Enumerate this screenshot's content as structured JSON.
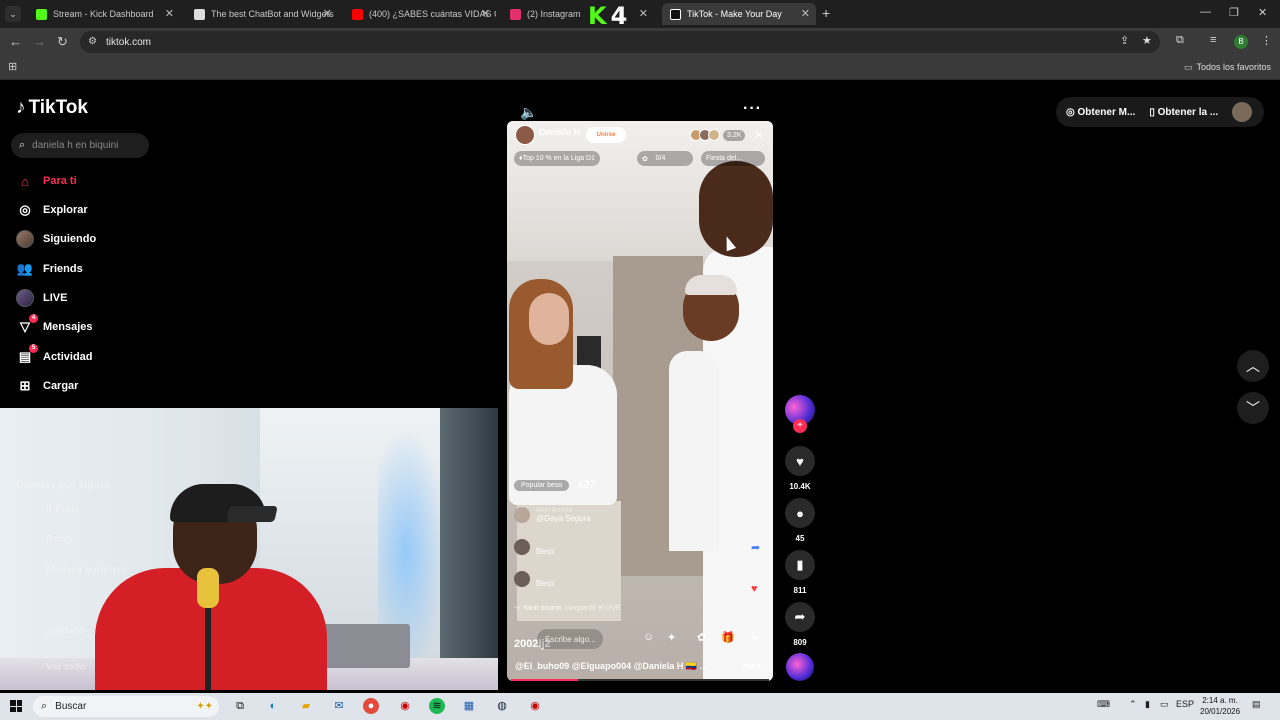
{
  "browser": {
    "tabs": [
      {
        "title": "Stream - Kick Dashboard",
        "color": "#53fc18"
      },
      {
        "title": "The best ChatBot and Widgets",
        "color": "#dddddd"
      },
      {
        "title": "(400) ¿SABES cuántas VIDAS CU",
        "color": "#ff0000"
      },
      {
        "title": "(2) Instagram",
        "color": "#e1306c"
      },
      {
        "title": "TikTok - Make Your Day",
        "color": "#ffffff"
      }
    ],
    "overlay_badge": {
      "letter": "K",
      "number": "4"
    },
    "url": "tiktok.com",
    "bookmarks_label": "Todos los favoritos"
  },
  "sidebar": {
    "brand": "TikTok",
    "search_placeholder": "daniela h en biquini",
    "items": [
      {
        "label": "Para ti",
        "icon": "home-icon"
      },
      {
        "label": "Explorar",
        "icon": "compass-icon"
      },
      {
        "label": "Siguiendo",
        "icon": "following-avatar"
      },
      {
        "label": "Friends",
        "icon": "friends-icon"
      },
      {
        "label": "LIVE",
        "icon": "live-avatar"
      },
      {
        "label": "Mensajes",
        "icon": "inbox-icon",
        "badge": "4"
      },
      {
        "label": "Actividad",
        "icon": "activity-icon",
        "badge": "5"
      },
      {
        "label": "Cargar",
        "icon": "upload-icon"
      }
    ],
    "faded": {
      "section": "Cuentas que sigues",
      "accounts": [
        "Ir Pista",
        "Rndg",
        "Melissa gutierrez",
        "marta06"
      ],
      "more": "Ver todo"
    }
  },
  "live": {
    "host_name": "Daniela H",
    "host_likes": "17.2K",
    "join_label": "Unirse",
    "viewer_count": "3.2K",
    "pill_rank": "Top 10 % en la Liga D1",
    "pill_progress": "0/4",
    "pill_event": "Fiesta del...",
    "popular_label": "Popular beso",
    "multiplier": "x27",
    "comments": [
      {
        "name": "Ariel Arroyo",
        "text": "@Daya Segura"
      },
      {
        "name": "",
        "text": "Beso"
      },
      {
        "name": "",
        "text": "Beso"
      }
    ],
    "share_user": "Yanir ocurrio",
    "share_text": "compartió el LIVE",
    "user_tag": "2002lj2",
    "compose_placeholder": "Escribe algo..."
  },
  "caption": {
    "text": "@El_buho09 @Elguapo004 @Daniela H 🇨🇴 ...",
    "more_label": "más",
    "progress_value": 0.26
  },
  "actions": {
    "likes": "10.4K",
    "comments": "45",
    "saves": "811",
    "shares": "809"
  },
  "header_right": {
    "get_coins": "Obtener M...",
    "get_app": "Obtener la ..."
  },
  "taskbar": {
    "search_label": "Buscar",
    "lang": "ESP",
    "time": "2:14 a. m.",
    "date": "20/01/2026"
  }
}
